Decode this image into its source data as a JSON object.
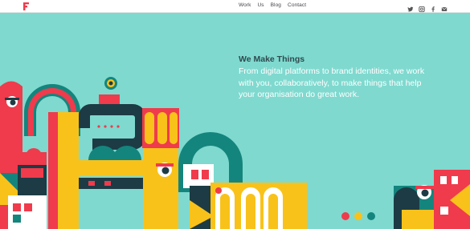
{
  "header": {
    "logo_icon": "f-logo-icon",
    "nav": [
      {
        "label": "Work"
      },
      {
        "label": "Us"
      },
      {
        "label": "Blog"
      },
      {
        "label": "Contact"
      }
    ],
    "social": [
      {
        "icon": "twitter-icon"
      },
      {
        "icon": "instagram-icon"
      },
      {
        "icon": "facebook-icon"
      },
      {
        "icon": "mail-icon"
      }
    ]
  },
  "hero": {
    "title": "We Make Things",
    "body": "From digital platforms to brand identities, we work with you, collaboratively, to make things that help your organisation do great work."
  },
  "colors": {
    "background": "#7fd9cf",
    "red": "#ef3b4c",
    "yellow": "#f9c21a",
    "teal": "#14857d",
    "navy": "#1d3b45",
    "white": "#ffffff"
  }
}
